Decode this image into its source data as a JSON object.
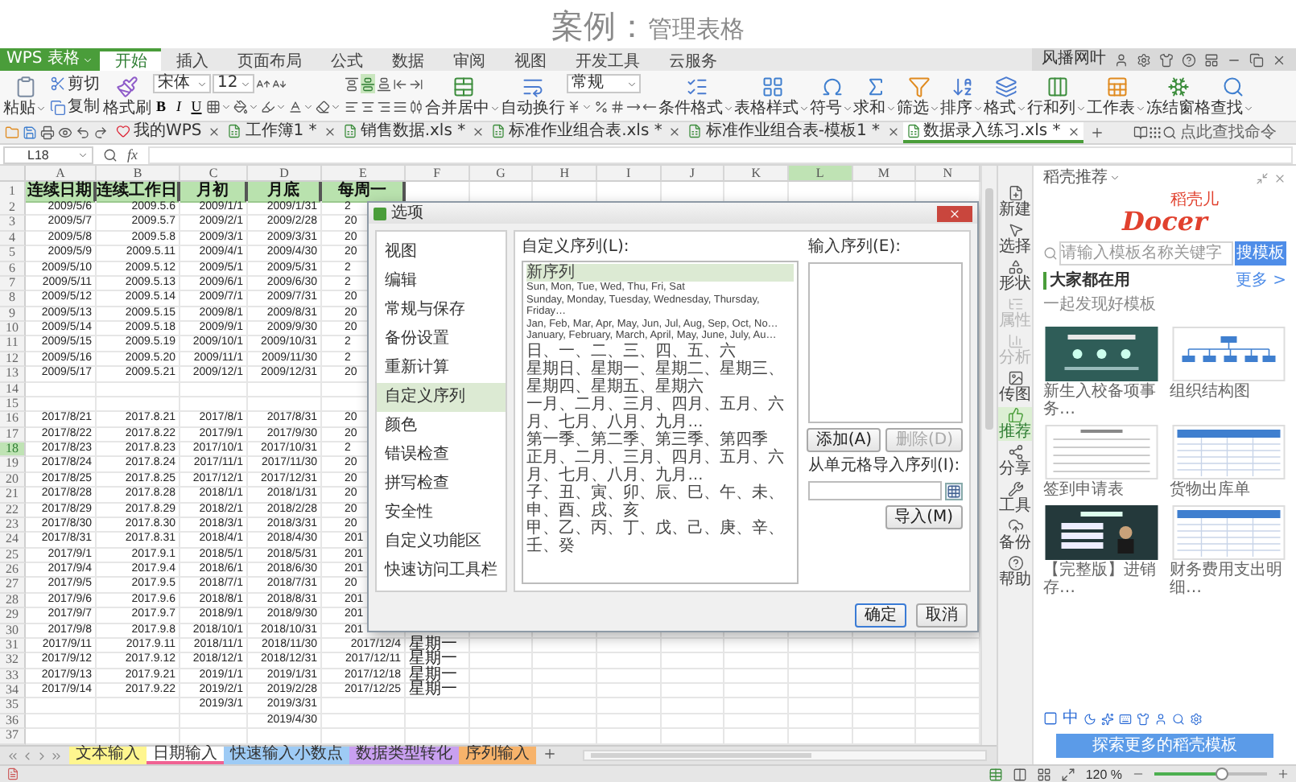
{
  "heading": {
    "lead": "案例：",
    "title": "管理表格"
  },
  "app": {
    "name": "WPS 表格"
  },
  "menu_tabs": [
    {
      "label": "开始",
      "selected": true
    },
    {
      "label": "插入",
      "selected": false
    },
    {
      "label": "页面布局",
      "selected": false
    },
    {
      "label": "公式",
      "selected": false
    },
    {
      "label": "数据",
      "selected": false
    },
    {
      "label": "审阅",
      "selected": false
    },
    {
      "label": "视图",
      "selected": false
    },
    {
      "label": "开发工具",
      "selected": false
    },
    {
      "label": "云服务",
      "selected": false
    }
  ],
  "account": {
    "user": "风播网叶"
  },
  "ribbon": [
    {
      "kind": "large",
      "label": "粘贴",
      "dropdown": true
    },
    {
      "kind": "stack",
      "upper": [
        {
          "kind": "button",
          "label": "剪切"
        }
      ],
      "lower": [
        {
          "kind": "button",
          "label": "复制"
        }
      ]
    },
    {
      "kind": "large",
      "label": "格式刷",
      "dropdown": false
    },
    {
      "kind": "stack",
      "upper": [
        {
          "kind": "field",
          "value": "宋体",
          "dropdown": true
        },
        {
          "kind": "field",
          "value": "12",
          "dropdown": true
        },
        {
          "kind": "tool",
          "dropdown": false
        },
        {
          "kind": "tool",
          "dropdown": false
        }
      ],
      "lower": [
        {
          "kind": "glyph",
          "label": "B"
        },
        {
          "kind": "glyph",
          "label": "I"
        },
        {
          "kind": "glyph",
          "label": "U"
        },
        {
          "kind": "tool",
          "dropdown": true
        },
        {
          "kind": "tool",
          "dropdown": true
        },
        {
          "kind": "tool",
          "dropdown": true
        },
        {
          "kind": "tool",
          "dropdown": true
        },
        {
          "kind": "tool",
          "dropdown": true
        }
      ]
    },
    {
      "kind": "stack",
      "upper": [
        {
          "kind": "tool",
          "on": false
        },
        {
          "kind": "tool",
          "on": true
        },
        {
          "kind": "tool",
          "on": false
        },
        {
          "kind": "tool",
          "on": false
        },
        {
          "kind": "tool",
          "on": false
        }
      ],
      "lower": [
        {
          "kind": "tool",
          "on": false
        },
        {
          "kind": "tool",
          "on": false
        },
        {
          "kind": "tool",
          "on": false
        },
        {
          "kind": "tool",
          "on": false
        },
        {
          "kind": "tool",
          "on": false
        }
      ]
    },
    {
      "kind": "large",
      "label": "合并居中",
      "dropdown": true
    },
    {
      "kind": "large",
      "label": "自动换行",
      "dropdown": false
    },
    {
      "kind": "stack",
      "upper": [
        {
          "kind": "field",
          "value": "常规",
          "dropdown": true
        }
      ],
      "lower": [
        {
          "kind": "tool",
          "dropdown": true
        },
        {
          "kind": "tool",
          "dropdown": false
        },
        {
          "kind": "tool",
          "dropdown": false
        },
        {
          "kind": "tool",
          "dropdown": false
        },
        {
          "kind": "tool",
          "dropdown": false
        }
      ]
    },
    {
      "kind": "large",
      "label": "条件格式",
      "dropdown": true
    },
    {
      "kind": "large",
      "label": "表格样式",
      "dropdown": true
    },
    {
      "kind": "large",
      "label": "符号",
      "dropdown": true
    },
    {
      "kind": "large",
      "label": "求和",
      "dropdown": true
    },
    {
      "kind": "large",
      "label": "筛选",
      "dropdown": true
    },
    {
      "kind": "large",
      "label": "排序",
      "dropdown": true
    },
    {
      "kind": "large",
      "label": "格式",
      "dropdown": true
    },
    {
      "kind": "large",
      "label": "行和列",
      "dropdown": true
    },
    {
      "kind": "large",
      "label": "工作表",
      "dropdown": true
    },
    {
      "kind": "large",
      "label": "冻结窗格",
      "dropdown": false
    },
    {
      "kind": "large",
      "label": "查找",
      "dropdown": true
    }
  ],
  "doc_tabs": [
    {
      "label": "我的WPS",
      "kind": "home",
      "selected": false
    },
    {
      "label": "工作簿1 *",
      "kind": "workbook",
      "selected": false
    },
    {
      "label": "销售数据.xls *",
      "kind": "workbook",
      "selected": false
    },
    {
      "label": "标准作业组合表.xls *",
      "kind": "workbook",
      "selected": false
    },
    {
      "label": "标准作业组合表-模板1 *",
      "kind": "workbook",
      "selected": false
    },
    {
      "label": "数据录入练习.xls *",
      "kind": "workbook",
      "selected": true
    }
  ],
  "command_search": {
    "placeholder": "点此查找命令"
  },
  "formula_bar": {
    "cell": "L18",
    "fx": "fx"
  },
  "grid": {
    "columns": [
      {
        "label": "A",
        "selected": false
      },
      {
        "label": "B",
        "selected": false
      },
      {
        "label": "C",
        "selected": false
      },
      {
        "label": "D",
        "selected": false
      },
      {
        "label": "E",
        "selected": false
      },
      {
        "label": "F",
        "selected": false
      },
      {
        "label": "G",
        "selected": false
      },
      {
        "label": "H",
        "selected": false
      },
      {
        "label": "I",
        "selected": false
      },
      {
        "label": "J",
        "selected": false
      },
      {
        "label": "K",
        "selected": false
      },
      {
        "label": "L",
        "selected": true
      },
      {
        "label": "M",
        "selected": false
      },
      {
        "label": "N",
        "selected": false
      }
    ],
    "header_row": {
      "n": "1",
      "selected": false,
      "A": "连续日期",
      "B": "连续工作日",
      "C": "月初",
      "D": "月底",
      "E": "每周一"
    },
    "rows": [
      {
        "n": "2",
        "selected": false,
        "A": "2009/5/6",
        "B": "2009.5.6",
        "C": "2009/1/1",
        "D": "2009/1/31",
        "E_cut": "2"
      },
      {
        "n": "3",
        "selected": false,
        "A": "2009/5/7",
        "B": "2009.5.7",
        "C": "2009/2/1",
        "D": "2009/2/28",
        "E_cut": "20"
      },
      {
        "n": "4",
        "selected": false,
        "A": "2009/5/8",
        "B": "2009.5.8",
        "C": "2009/3/1",
        "D": "2009/3/31",
        "E_cut": "20"
      },
      {
        "n": "5",
        "selected": false,
        "A": "2009/5/9",
        "B": "2009.5.11",
        "C": "2009/4/1",
        "D": "2009/4/30",
        "E_cut": "20"
      },
      {
        "n": "6",
        "selected": false,
        "A": "2009/5/10",
        "B": "2009.5.12",
        "C": "2009/5/1",
        "D": "2009/5/31",
        "E_cut": "2"
      },
      {
        "n": "7",
        "selected": false,
        "A": "2009/5/11",
        "B": "2009.5.13",
        "C": "2009/6/1",
        "D": "2009/6/30",
        "E_cut": "2"
      },
      {
        "n": "8",
        "selected": false,
        "A": "2009/5/12",
        "B": "2009.5.14",
        "C": "2009/7/1",
        "D": "2009/7/31",
        "E_cut": "20"
      },
      {
        "n": "9",
        "selected": false,
        "A": "2009/5/13",
        "B": "2009.5.15",
        "C": "2009/8/1",
        "D": "2009/8/31",
        "E_cut": "20"
      },
      {
        "n": "10",
        "selected": false,
        "A": "2009/5/14",
        "B": "2009.5.18",
        "C": "2009/9/1",
        "D": "2009/9/30",
        "E_cut": "20"
      },
      {
        "n": "11",
        "selected": false,
        "A": "2009/5/15",
        "B": "2009.5.19",
        "C": "2009/10/1",
        "D": "2009/10/31",
        "E_cut": "2"
      },
      {
        "n": "12",
        "selected": false,
        "A": "2009/5/16",
        "B": "2009.5.20",
        "C": "2009/11/1",
        "D": "2009/11/30",
        "E_cut": "2"
      },
      {
        "n": "13",
        "selected": false,
        "A": "2009/5/17",
        "B": "2009.5.21",
        "C": "2009/12/1",
        "D": "2009/12/31",
        "E_cut": "20"
      },
      {
        "n": "14",
        "selected": false
      },
      {
        "n": "15",
        "selected": false
      },
      {
        "n": "16",
        "selected": false,
        "A": "2017/8/21",
        "B": "2017.8.21",
        "C": "2017/8/1",
        "D": "2017/8/31",
        "E_cut": "20"
      },
      {
        "n": "17",
        "selected": false,
        "A": "2017/8/22",
        "B": "2017.8.22",
        "C": "2017/9/1",
        "D": "2017/9/30",
        "E_cut": "20"
      },
      {
        "n": "18",
        "selected": true,
        "A": "2017/8/23",
        "B": "2017.8.23",
        "C": "2017/10/1",
        "D": "2017/10/31",
        "E_cut": "2"
      },
      {
        "n": "19",
        "selected": false,
        "A": "2017/8/24",
        "B": "2017.8.24",
        "C": "2017/11/1",
        "D": "2017/11/30",
        "E_cut": "20"
      },
      {
        "n": "20",
        "selected": false,
        "A": "2017/8/25",
        "B": "2017.8.25",
        "C": "2017/12/1",
        "D": "2017/12/31",
        "E_cut": "20"
      },
      {
        "n": "21",
        "selected": false,
        "A": "2017/8/28",
        "B": "2017.8.28",
        "C": "2018/1/1",
        "D": "2018/1/31",
        "E_cut": "20"
      },
      {
        "n": "22",
        "selected": false,
        "A": "2017/8/29",
        "B": "2017.8.29",
        "C": "2018/2/1",
        "D": "2018/2/28",
        "E_cut": "20"
      },
      {
        "n": "23",
        "selected": false,
        "A": "2017/8/30",
        "B": "2017.8.30",
        "C": "2018/3/1",
        "D": "2018/3/31",
        "E_cut": "20"
      },
      {
        "n": "24",
        "selected": false,
        "A": "2017/8/31",
        "B": "2017.8.31",
        "C": "2018/4/1",
        "D": "2018/4/30",
        "E_cut": "201"
      },
      {
        "n": "25",
        "selected": false,
        "A": "2017/9/1",
        "B": "2017.9.1",
        "C": "2018/5/1",
        "D": "2018/5/31",
        "E_cut": "201"
      },
      {
        "n": "26",
        "selected": false,
        "A": "2017/9/4",
        "B": "2017.9.4",
        "C": "2018/6/1",
        "D": "2018/6/30",
        "E_cut": "201"
      },
      {
        "n": "27",
        "selected": false,
        "A": "2017/9/5",
        "B": "2017.9.5",
        "C": "2018/7/1",
        "D": "2018/7/31",
        "E_cut": "20"
      },
      {
        "n": "28",
        "selected": false,
        "A": "2017/9/6",
        "B": "2017.9.6",
        "C": "2018/8/1",
        "D": "2018/8/31",
        "E_cut": "201"
      },
      {
        "n": "29",
        "selected": false,
        "A": "2017/9/7",
        "B": "2017.9.7",
        "C": "2018/9/1",
        "D": "2018/9/30",
        "E_cut": "201"
      },
      {
        "n": "30",
        "selected": false,
        "A": "2017/9/8",
        "B": "2017.9.8",
        "C": "2018/10/1",
        "D": "2018/10/31",
        "E_cut": "201"
      },
      {
        "n": "31",
        "selected": false,
        "A": "2017/9/11",
        "B": "2017.9.11",
        "C": "2018/11/1",
        "D": "2018/11/30",
        "E": "2017/12/4",
        "F": "星期一"
      },
      {
        "n": "32",
        "selected": false,
        "A": "2017/9/12",
        "B": "2017.9.12",
        "C": "2018/12/1",
        "D": "2018/12/31",
        "E": "2017/12/11",
        "F": "星期一"
      },
      {
        "n": "33",
        "selected": false,
        "A": "2017/9/13",
        "B": "2017.9.21",
        "C": "2019/1/1",
        "D": "2019/1/31",
        "E": "2017/12/18",
        "F": "星期一"
      },
      {
        "n": "34",
        "selected": false,
        "A": "2017/9/14",
        "B": "2017.9.22",
        "C": "2019/2/1",
        "D": "2019/2/28",
        "E": "2017/12/25",
        "F": "星期一"
      },
      {
        "n": "35",
        "selected": false,
        "C": "2019/3/1",
        "D": "2019/3/31"
      },
      {
        "n": "36",
        "selected": false,
        "D": "2019/4/30"
      },
      {
        "n": "37",
        "selected": false
      }
    ]
  },
  "dialog": {
    "title": "选项",
    "nav": [
      {
        "label": "视图",
        "selected": false
      },
      {
        "label": "编辑",
        "selected": false
      },
      {
        "label": "常规与保存",
        "selected": false
      },
      {
        "label": "备份设置",
        "selected": false
      },
      {
        "label": "重新计算",
        "selected": false
      },
      {
        "label": "自定义序列",
        "selected": true
      },
      {
        "label": "颜色",
        "selected": false
      },
      {
        "label": "错误检查",
        "selected": false
      },
      {
        "label": "拼写检查",
        "selected": false
      },
      {
        "label": "安全性",
        "selected": false
      },
      {
        "label": "自定义功能区",
        "selected": false
      },
      {
        "label": "快速访问工具栏",
        "selected": false
      }
    ],
    "series_label": "自定义序列(L):",
    "series": [
      {
        "label": "新序列",
        "kind": "cjk",
        "selected": true
      },
      {
        "label": "Sun, Mon, Tue, Wed, Thu, Fri, Sat",
        "kind": "latin",
        "selected": false
      },
      {
        "label": "Sunday, Monday, Tuesday, Wednesday, Thursday, Friday…",
        "kind": "latin",
        "selected": false
      },
      {
        "label": "Jan, Feb, Mar, Apr, May, Jun, Jul, Aug, Sep, Oct, No…",
        "kind": "latin",
        "selected": false
      },
      {
        "label": "January, February, March, April, May, June, July, Au…",
        "kind": "latin",
        "selected": false
      },
      {
        "label": "日、一、二、三、四、五、六",
        "kind": "cjk",
        "selected": false
      },
      {
        "label": "星期日、星期一、星期二、星期三、星期四、星期五、星期六",
        "kind": "cjk",
        "selected": false
      },
      {
        "label": "一月、二月、三月、四月、五月、六月、七月、八月、九月…",
        "kind": "cjk",
        "selected": false
      },
      {
        "label": "第一季、第二季、第三季、第四季",
        "kind": "cjk",
        "selected": false
      },
      {
        "label": "正月、二月、三月、四月、五月、六月、七月、八月、九月…",
        "kind": "cjk",
        "selected": false
      },
      {
        "label": "子、丑、寅、卯、辰、巳、午、未、申、酉、戌、亥",
        "kind": "cjk",
        "selected": false
      },
      {
        "label": "甲、乙、丙、丁、戊、己、庚、辛、壬、癸",
        "kind": "cjk",
        "selected": false
      }
    ],
    "entry_label": "输入序列(E):",
    "entry_buttons": [
      {
        "label": "添加(A)",
        "disabled": false
      },
      {
        "label": "删除(D)",
        "disabled": true
      }
    ],
    "import_label": "从单元格导入序列(I):",
    "import_button": "导入(M)",
    "footer": [
      {
        "label": "确定",
        "default": true
      },
      {
        "label": "取消",
        "default": false
      }
    ]
  },
  "sheet_tabs": [
    {
      "label": "文本输入",
      "color": "#fff68f",
      "selected": false
    },
    {
      "label": "日期输入",
      "color": "#f06292",
      "selected": true
    },
    {
      "label": "快速输入小数点",
      "color": "#9ecbf5",
      "selected": false
    },
    {
      "label": "数据类型转化",
      "color": "#c9a0f0",
      "selected": false
    },
    {
      "label": "序列输入",
      "color": "#f7b36b",
      "selected": false
    }
  ],
  "side_tools": [
    {
      "label": "新建",
      "disabled": false,
      "selected": false
    },
    {
      "label": "选择",
      "disabled": false,
      "selected": false
    },
    {
      "label": "形状",
      "disabled": false,
      "selected": false
    },
    {
      "label": "属性",
      "disabled": true,
      "selected": false
    },
    {
      "label": "分析",
      "disabled": true,
      "selected": false
    },
    {
      "label": "传图",
      "disabled": false,
      "selected": false
    },
    {
      "label": "推荐",
      "disabled": false,
      "selected": true
    },
    {
      "label": "分享",
      "disabled": false,
      "selected": false
    },
    {
      "label": "工具",
      "disabled": false,
      "selected": false
    },
    {
      "label": "备份",
      "disabled": false,
      "selected": false
    },
    {
      "label": "帮助",
      "disabled": false,
      "selected": false
    }
  ],
  "template_panel": {
    "title": "稻壳推荐",
    "logo": {
      "name": "Docer",
      "tagline": "稻壳儿"
    },
    "search": {
      "placeholder": "请输入模板名称关键字",
      "button": "搜模板"
    },
    "section": {
      "title": "大家都在用",
      "more": "更多 >",
      "subtitle": "一起发现好模板"
    },
    "templates": [
      {
        "caption": "新生入校备项事务…",
        "kind": "dark-slide"
      },
      {
        "caption": "组织结构图",
        "kind": "org-chart"
      },
      {
        "caption": "签到申请表",
        "kind": "form"
      },
      {
        "caption": "货物出库单",
        "kind": "table"
      },
      {
        "caption": "【完整版】进销存…",
        "kind": "dark-list"
      },
      {
        "caption": "财务费用支出明细…",
        "kind": "table"
      }
    ],
    "ime_mode": "中",
    "explore_button": "探索更多的稻壳模板"
  },
  "status_bar": {
    "zoom": {
      "reading": "120 %",
      "level": 0.6
    }
  }
}
